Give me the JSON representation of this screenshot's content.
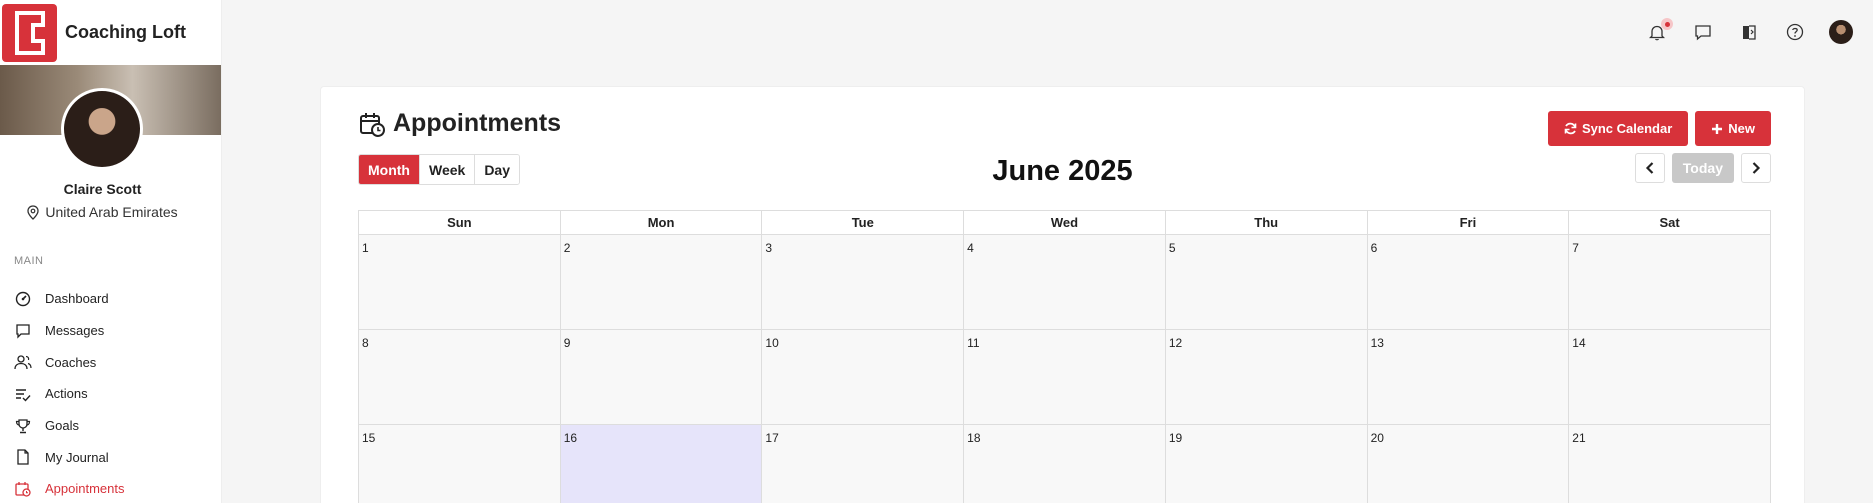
{
  "brand": {
    "name": "Coaching Loft",
    "accent": "#d7323a"
  },
  "profile": {
    "name": "Claire Scott",
    "location": "United Arab Emirates"
  },
  "sidebar": {
    "section_label": "MAIN",
    "items": [
      {
        "label": "Dashboard",
        "icon": "gauge-icon"
      },
      {
        "label": "Messages",
        "icon": "message-icon"
      },
      {
        "label": "Coaches",
        "icon": "users-icon"
      },
      {
        "label": "Actions",
        "icon": "checklist-icon"
      },
      {
        "label": "Goals",
        "icon": "trophy-icon"
      },
      {
        "label": "My Journal",
        "icon": "document-icon"
      },
      {
        "label": "Appointments",
        "icon": "calendar-clock-icon",
        "active": true
      }
    ]
  },
  "topbar": {
    "icons": [
      "bell-icon",
      "chat-icon",
      "book-icon",
      "help-icon",
      "avatar"
    ]
  },
  "page": {
    "title": "Appointments",
    "sync_label": "Sync Calendar",
    "new_label": "New"
  },
  "calendar": {
    "views": [
      "Month",
      "Week",
      "Day"
    ],
    "active_view": "Month",
    "title": "June 2025",
    "today_label": "Today",
    "days_of_week": [
      "Sun",
      "Mon",
      "Tue",
      "Wed",
      "Thu",
      "Fri",
      "Sat"
    ],
    "weeks": [
      [
        "1",
        "2",
        "3",
        "4",
        "5",
        "6",
        "7"
      ],
      [
        "8",
        "9",
        "10",
        "11",
        "12",
        "13",
        "14"
      ],
      [
        "15",
        "16",
        "17",
        "18",
        "19",
        "20",
        "21"
      ]
    ],
    "highlighted_day": "16"
  }
}
